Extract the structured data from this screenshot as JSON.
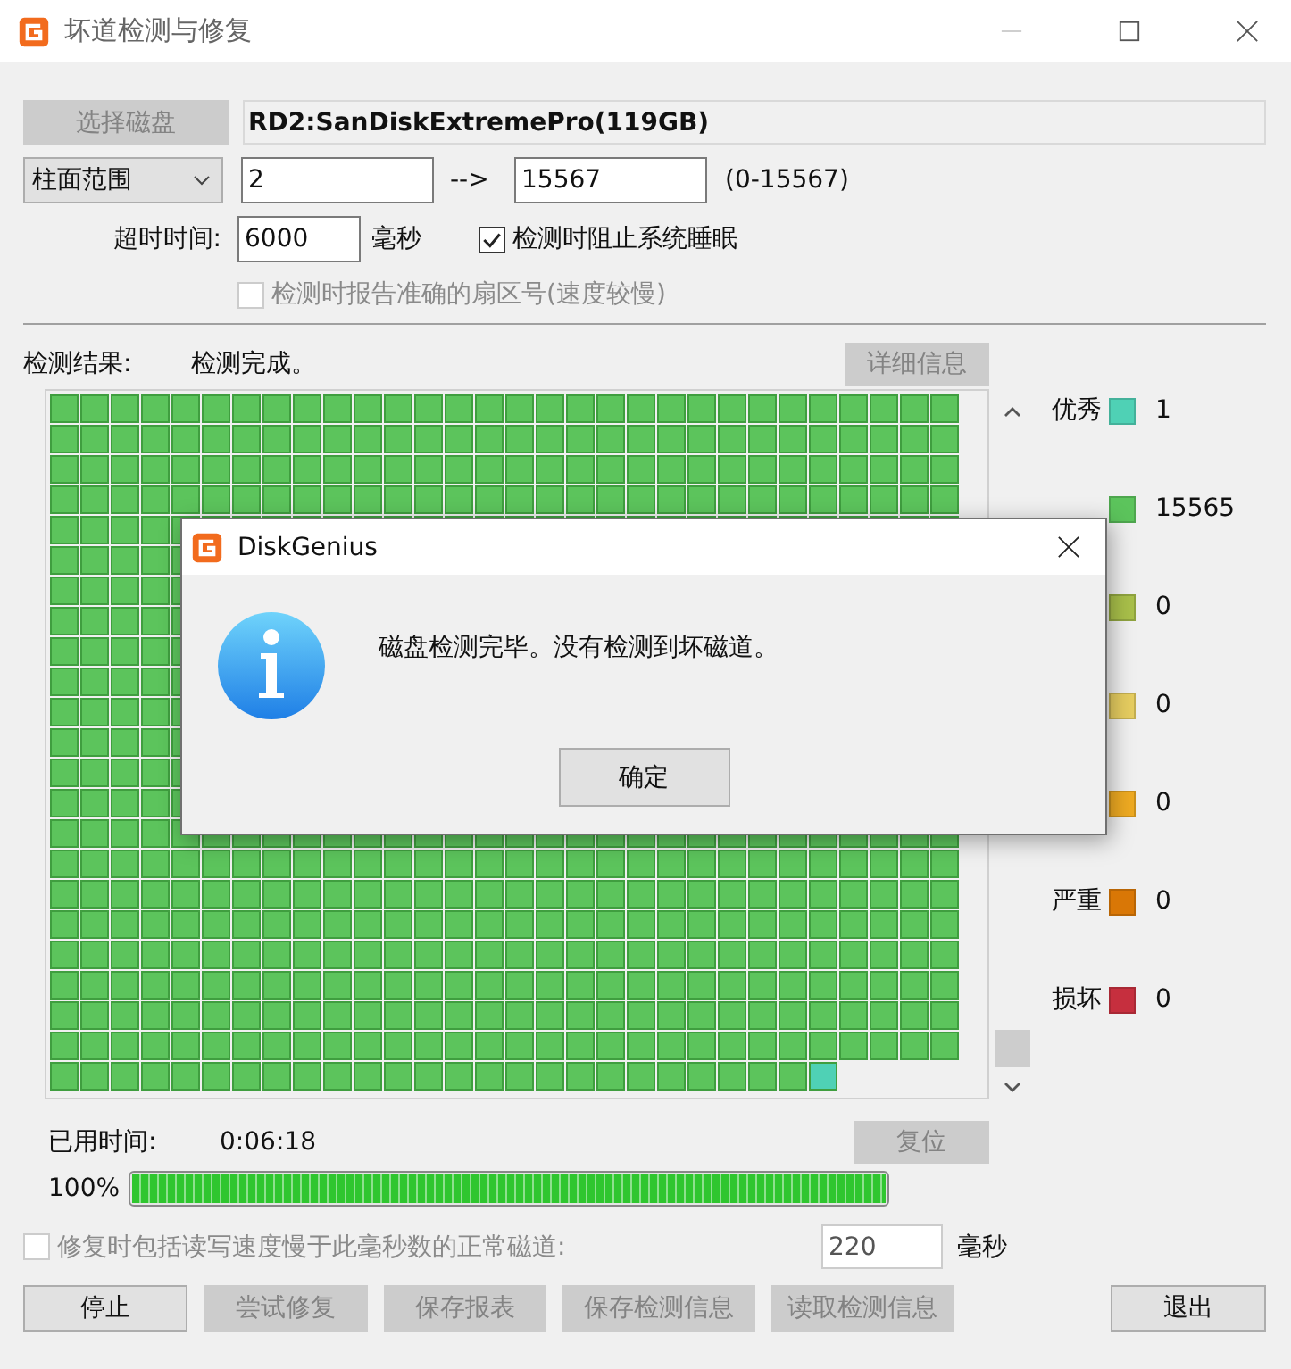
{
  "window": {
    "title": "坏道检测与修复"
  },
  "disk": {
    "button": {
      "label": "选择磁盘",
      "disabled": true
    },
    "name": "RD2:SanDiskExtremePro(119GB)"
  },
  "range": {
    "mode": "柱面范围",
    "from": "2",
    "arrow": "-->",
    "to": "15567",
    "bounds": "(0-15567)"
  },
  "timeout": {
    "label": "超时时间:",
    "value": "6000",
    "unit": "毫秒"
  },
  "options": [
    {
      "label": "检测时阻止系统睡眠",
      "checked": true,
      "disabled": false
    },
    {
      "label": "检测时报告准确的扇区号(速度较慢)",
      "checked": false,
      "disabled": true
    }
  ],
  "result": {
    "label": "检测结果:",
    "status": "检测完成。",
    "details_button": {
      "label": "详细信息",
      "disabled": true
    }
  },
  "legend": [
    {
      "label": "优秀",
      "color": "#4fd1b5",
      "count": "1"
    },
    {
      "color": "#5cc45c",
      "count": "15565"
    },
    {
      "color": "#a9c04a",
      "count": "0"
    },
    {
      "color": "#e6cd60",
      "count": "0"
    },
    {
      "color": "#eeaa22",
      "count": "0"
    },
    {
      "label": "严重",
      "color": "#d97706",
      "count": "0"
    },
    {
      "label": "损坏",
      "color": "#c62f3e",
      "count": "0"
    }
  ],
  "elapsed": {
    "label": "已用时间:",
    "value": "0:06:18",
    "reset_button": {
      "label": "复位",
      "disabled": true
    }
  },
  "progress": {
    "percent": "100%",
    "level": 1
  },
  "repair_option": {
    "label": "修复时包括读写速度慢于此毫秒数的正常磁道:",
    "checked": false,
    "value": "220",
    "unit": "毫秒"
  },
  "buttons": [
    {
      "label": "停止",
      "disabled": false
    },
    {
      "label": "尝试修复",
      "disabled": true
    },
    {
      "label": "保存报表",
      "disabled": true
    },
    {
      "label": "保存检测信息",
      "disabled": true
    },
    {
      "label": "读取检测信息",
      "disabled": true
    },
    {
      "label": "退出",
      "disabled": false
    }
  ],
  "dialog": {
    "title": "DiskGenius",
    "message": "磁盘检测完毕。没有检测到坏磁道。",
    "button": "确定"
  }
}
